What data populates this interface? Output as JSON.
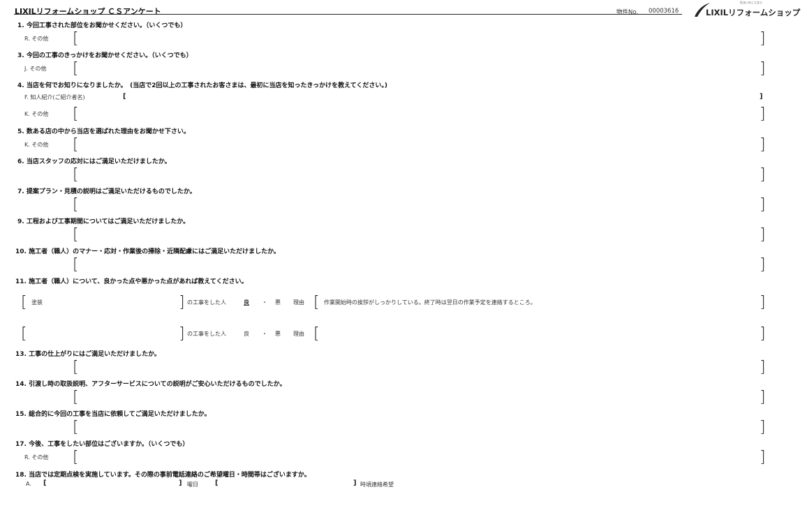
{
  "header": {
    "title": "LIXILリフォームショップ ＣＳアンケート",
    "property_label": "物件No.",
    "property_no": "00003616",
    "logo_text": "LIXILリフォームショップ",
    "logo_tagline": "住まいのことなら"
  },
  "questions": [
    {
      "q": "1. 今回工事された部位をお聞かせください。（いくつでも）",
      "opt": "R. その他"
    },
    {
      "q": "3. 今回の工事のきっかけをお聞かせください。（いくつでも）",
      "opt": "J. その他"
    },
    {
      "q": "4. 当店を何でお知りになりましたか。　(当店で2回以上の工事されたお客さまは、最初に当店を知ったきっかけを教えてください。)",
      "opt": "F. 知人紹介(ご紹介者名)",
      "opt2": "K. その他"
    },
    {
      "q": "5. 数ある店の中から当店を選ばれた理由をお聞かせ下さい。",
      "opt": "K. その他"
    },
    {
      "q": "6. 当店スタッフの応対にはご満足いただけましたか。"
    },
    {
      "q": "7. 提案プラン・見積の説明はご満足いただけるものでしたか。"
    },
    {
      "q": "9. 工程および工事期間についてはご満足いただけましたか。"
    },
    {
      "q": "10. 施工者（職人）のマナー・応対・作業後の掃除・近隣配慮にはご満足いただけましたか。"
    },
    {
      "q": "11. 施工者（職人）について、良かった点や悪かった点があれば教えてください。"
    },
    {
      "q": "13. 工事の仕上がりにはご満足いただけましたか。"
    },
    {
      "q": "14. 引渡し時の取扱説明、アフターサービスについての説明がご安心いただけるものでしたか。"
    },
    {
      "q": "15. 総合的に今回の工事を当店に依頼してご満足いただけましたか。"
    },
    {
      "q": "17. 今後、工事をしたい部位はございますか。（いくつでも）",
      "opt": "R. その他"
    },
    {
      "q": "18. 当店では定期点検を実施しています。その際の事前電話連絡のご希望曜日・時間帯はございますか。",
      "opt": "A."
    }
  ],
  "q11": {
    "row1": {
      "trade": "塗装",
      "suffix": "の工事をした人",
      "good": "良",
      "dot": "・",
      "bad": "悪",
      "reason_label": "理由",
      "reason": "作業開始時の挨拶がしっかりしている。終了時は翌日の作業予定を連絡するところ。"
    },
    "row2": {
      "trade": "",
      "suffix": "の工事をした人",
      "good": "良",
      "dot": "・",
      "bad": "悪",
      "reason_label": "理由",
      "reason": ""
    }
  },
  "q18": {
    "day_suffix": "曜日",
    "time_suffix": "時頃連絡希望"
  },
  "brackets": {
    "open": "[",
    "close": "]"
  }
}
